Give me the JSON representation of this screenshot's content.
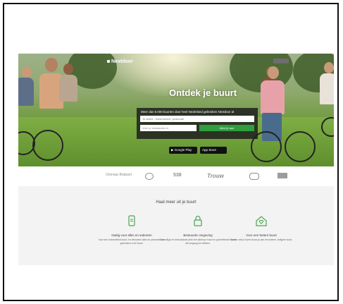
{
  "header": {
    "logo_text": "Nextdoor"
  },
  "hero": {
    "title": "Ontdek je buurt",
    "signup_text": "Meer dan 5.000 buurten door heel Nederland gebruiken Nextdoor al",
    "address_placeholder": "Je adres - huisnummer, postcode",
    "zip_placeholder": "Voer je emailadres in",
    "signup_button": "Meld je aan",
    "google_play": "Google Play",
    "app_store": "App Store"
  },
  "media_logos": [
    "Omroep Brabant",
    "",
    "538",
    "Trouw",
    "",
    ""
  ],
  "features_section": {
    "title": "Haal meer uit je buurt",
    "items": [
      {
        "title": "Nuttig voor alles en iedereen",
        "desc": "Voor een hoeveelheid buurt- en bewoners alles en personen van gebruikers in de buurt."
      },
      {
        "title": "Bestuurde omgeving",
        "desc": "Een veilige en betrouwbare plek met alleen je buurt en geverifieerde buren die toegang toe hebben."
      },
      {
        "title": "Voor een betere buurt",
        "desc": "Samen met je buren bouw je aan een betere, veiligere buurt."
      }
    ]
  },
  "colors": {
    "accent_green": "#2e9e3e",
    "icon_green": "#4aa552"
  }
}
